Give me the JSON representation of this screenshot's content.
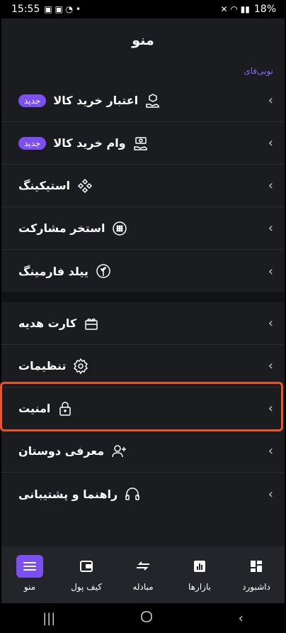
{
  "status": {
    "time": "15:55",
    "battery": "18%"
  },
  "header": {
    "title": "منو"
  },
  "section_label": "نوبی‌فای",
  "menu_group1": [
    {
      "label": "اعتبار خرید کالا",
      "badge": "جدید",
      "icon": "package-hand-icon"
    },
    {
      "label": "وام خرید کالا",
      "badge": "جدید",
      "icon": "cash-hand-icon"
    },
    {
      "label": "استیکینگ",
      "icon": "staking-icon"
    },
    {
      "label": "استخر مشارکت",
      "icon": "pool-icon"
    },
    {
      "label": "ییلد فارمینگ",
      "icon": "yield-farming-icon"
    }
  ],
  "menu_group2": [
    {
      "label": "کارت هدیه",
      "icon": "gift-card-icon"
    },
    {
      "label": "تنظیمات",
      "icon": "settings-icon"
    },
    {
      "label": "امنیت",
      "icon": "lock-icon"
    },
    {
      "label": "معرفی دوستان",
      "icon": "add-user-icon"
    },
    {
      "label": "راهنما و پشتیبانی",
      "icon": "headphones-icon"
    }
  ],
  "bottom_nav": [
    {
      "label": "منو",
      "icon": "menu-icon",
      "active": true
    },
    {
      "label": "کیف پول",
      "icon": "wallet-icon"
    },
    {
      "label": "مبادله",
      "icon": "exchange-icon"
    },
    {
      "label": "بازارها",
      "icon": "chart-icon"
    },
    {
      "label": "داشبورد",
      "icon": "dashboard-icon"
    }
  ],
  "colors": {
    "accent": "#7b4ff0",
    "highlight": "#e9542d",
    "background": "#1b1c20"
  }
}
